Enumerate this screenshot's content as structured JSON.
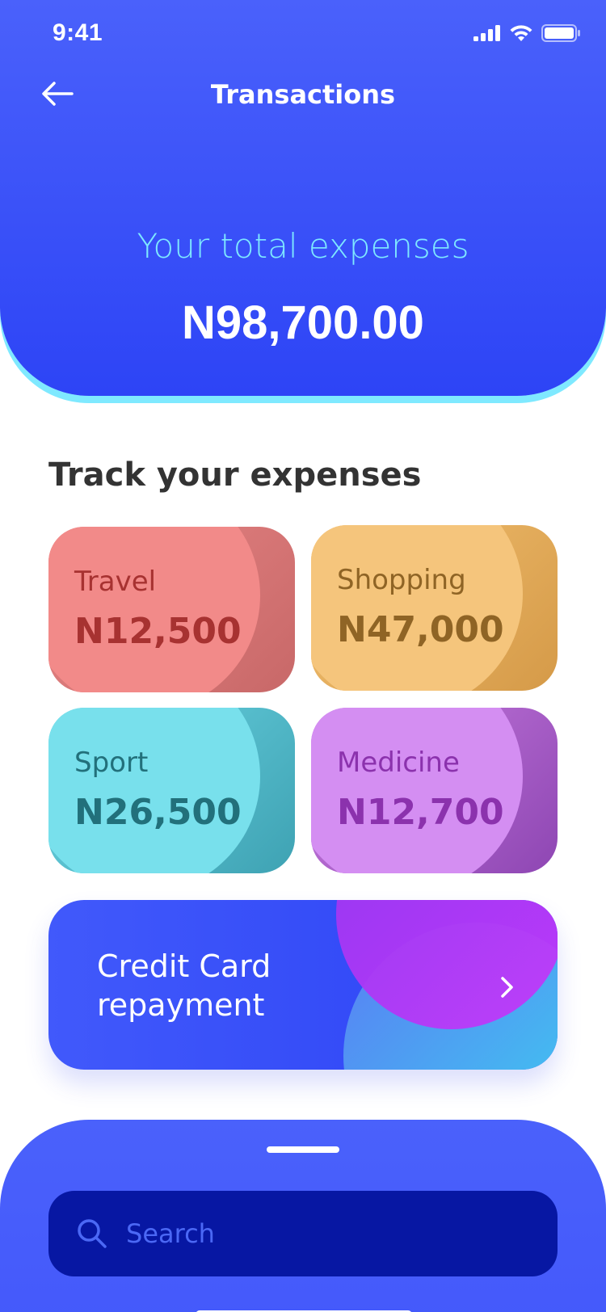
{
  "status_bar": {
    "time": "9:41"
  },
  "header": {
    "title": "Transactions",
    "total_label": "Your total expenses",
    "total_amount": "N98,700.00"
  },
  "section_title": "Track your expenses",
  "categories": [
    {
      "label": "Travel",
      "amount": "N12,500",
      "color": "#e78686"
    },
    {
      "label": "Shopping",
      "amount": "N47,000",
      "color": "#f2c071"
    },
    {
      "label": "Sport",
      "amount": "N26,500",
      "color": "#6cd5e3"
    },
    {
      "label": "Medicine",
      "amount": "N12,700",
      "color": "#c87ddf"
    }
  ],
  "credit_card": {
    "line1": "Credit Card",
    "line2": "repayment"
  },
  "search": {
    "placeholder": "Search"
  },
  "icons": [
    "back-arrow-icon",
    "signal-icon",
    "wifi-icon",
    "battery-icon",
    "chevron-right-icon",
    "search-icon"
  ],
  "colors": {
    "primary": "#3a51f8",
    "accent": "#7ee8ff",
    "search_bg": "#0717a3"
  }
}
